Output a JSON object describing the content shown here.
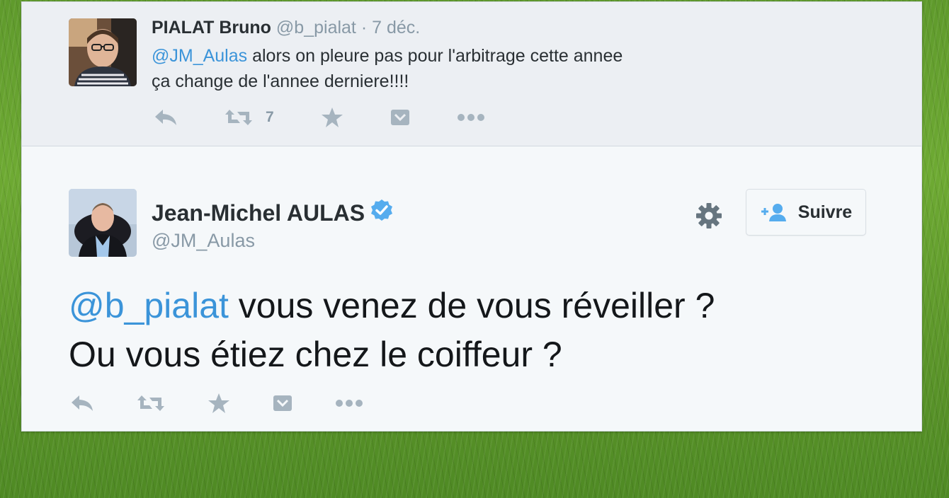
{
  "parent_tweet": {
    "author_name": "PIALAT Bruno",
    "handle": "@b_pialat",
    "separator": "·",
    "date": "7 déc.",
    "mention": "@JM_Aulas",
    "text_line1_rest": " alors on pleure pas pour l'arbitrage cette annee",
    "text_line2": "ça change de l'annee derniere!!!!",
    "retweet_count": "7",
    "icons": [
      "reply-icon",
      "retweet-icon",
      "favorite-icon",
      "pocket-icon",
      "more-icon"
    ]
  },
  "main_tweet": {
    "author_name": "Jean-Michel AULAS",
    "handle": "@JM_Aulas",
    "verified": true,
    "follow_label": "Suivre",
    "mention": "@b_pialat",
    "text_line1_rest": " vous venez de vous réveiller ?",
    "text_line2": "Ou vous étiez chez le coiffeur ?",
    "icons": [
      "reply-icon",
      "retweet-icon",
      "favorite-icon",
      "pocket-icon",
      "more-icon",
      "gear-icon",
      "add-user-icon",
      "verified-badge-icon"
    ]
  },
  "colors": {
    "link": "#3b94d9",
    "verified": "#55acee",
    "muted": "#8899a6",
    "action_icon": "#a6b4bf",
    "text": "#292f33"
  }
}
